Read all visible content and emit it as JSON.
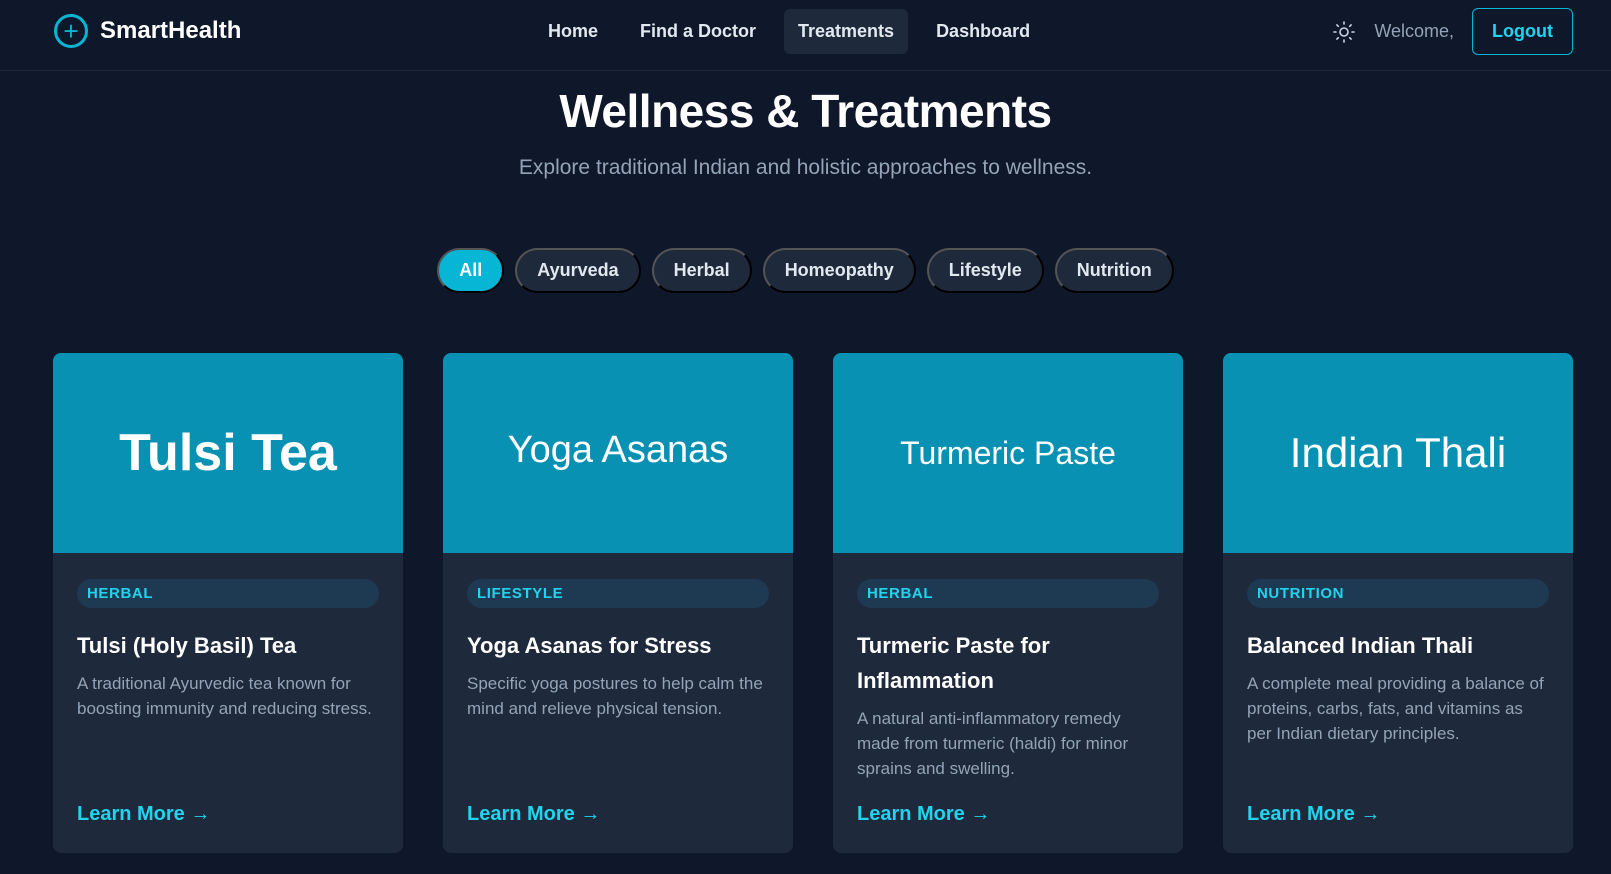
{
  "brand": {
    "name": "SmartHealth",
    "icon": "plus-circle-icon",
    "accent": "#06b6d4"
  },
  "nav": {
    "links": [
      {
        "label": "Home",
        "active": false
      },
      {
        "label": "Find a Doctor",
        "active": false
      },
      {
        "label": "Treatments",
        "active": true
      },
      {
        "label": "Dashboard",
        "active": false
      }
    ],
    "theme_icon": "sun-icon",
    "welcome": "Welcome,",
    "logout": "Logout"
  },
  "hero": {
    "title": "Wellness & Treatments",
    "subtitle": "Explore traditional Indian and holistic approaches to wellness."
  },
  "filters": [
    {
      "label": "All",
      "active": true
    },
    {
      "label": "Ayurveda",
      "active": false
    },
    {
      "label": "Herbal",
      "active": false
    },
    {
      "label": "Homeopathy",
      "active": false
    },
    {
      "label": "Lifestyle",
      "active": false
    },
    {
      "label": "Nutrition",
      "active": false
    }
  ],
  "cards": [
    {
      "banner": "Tulsi Tea",
      "tag": "HERBAL",
      "title": "Tulsi (Holy Basil) Tea",
      "description": "A traditional Ayurvedic tea known for boosting immunity and reducing stress.",
      "link": "Learn More →"
    },
    {
      "banner": "Yoga Asanas",
      "tag": "LIFESTYLE",
      "title": "Yoga Asanas for Stress",
      "description": "Specific yoga postures to help calm the mind and relieve physical tension.",
      "link": "Learn More →"
    },
    {
      "banner": "Turmeric Paste",
      "tag": "HERBAL",
      "title": "Turmeric Paste for Inflammation",
      "description": "A natural anti-inflammatory remedy made from turmeric (haldi) for minor sprains and swelling.",
      "link": "Learn More →"
    },
    {
      "banner": "Indian Thali",
      "tag": "NUTRITION",
      "title": "Balanced Indian Thali",
      "description": "A complete meal providing a balance of proteins, carbs, fats, and vitamins as per Indian dietary principles.",
      "link": "Learn More →"
    }
  ],
  "colors": {
    "background": "#0f172a",
    "surface": "#1e293b",
    "banner": "#0891b2",
    "accent": "#22d3ee"
  }
}
